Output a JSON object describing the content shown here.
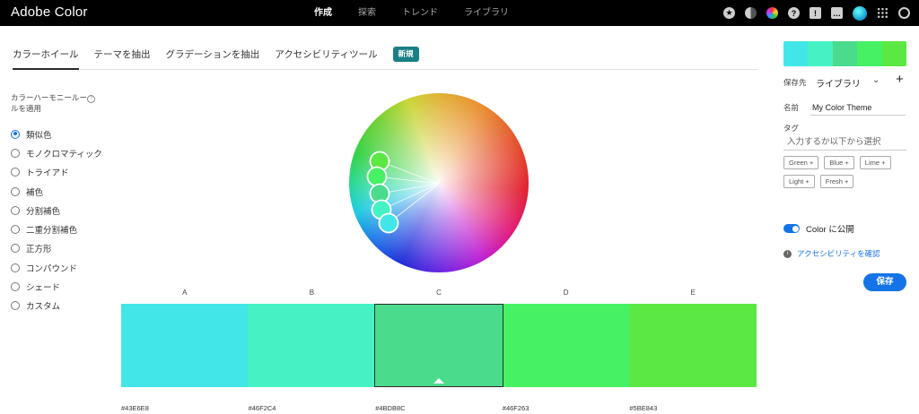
{
  "app": {
    "brand": "Adobe Color",
    "nav": [
      "作成",
      "探索",
      "トレンド",
      "ライブラリ"
    ],
    "active_nav": 0
  },
  "header_icons": [
    "star-icon",
    "contrast-icon",
    "color-wheel-icon",
    "help-icon",
    "alert-icon",
    "chat-icon",
    "avatar",
    "apps-grid-icon",
    "creative-cloud-icon"
  ],
  "tabs": {
    "items": [
      "カラーホイール",
      "テーマを抽出",
      "グラデーションを抽出",
      "アクセシビリティツール"
    ],
    "active": 0,
    "new_badge": "新規"
  },
  "harmony": {
    "title": "カラーハーモニールールを適用",
    "help": "?",
    "rules": [
      "類似色",
      "モノクロマティック",
      "トライアド",
      "補色",
      "分割補色",
      "二重分割補色",
      "正方形",
      "コンパウンド",
      "シェード",
      "カスタム"
    ],
    "selected": 0
  },
  "swatches": [
    {
      "label": "A",
      "hex": "#43E6E8"
    },
    {
      "label": "B",
      "hex": "#46F2C4"
    },
    {
      "label": "C",
      "hex": "#4BDB8C"
    },
    {
      "label": "D",
      "hex": "#46F263"
    },
    {
      "label": "E",
      "hex": "#5BE843"
    }
  ],
  "selected_swatch": 2,
  "panel": {
    "save_to_label": "保存先",
    "save_to_value": "ライブラリ",
    "name_label": "名前",
    "name_value": "My Color Theme",
    "tag_label": "タグ",
    "tag_placeholder": "入力するか以下から選択",
    "tags": [
      "Green +",
      "Blue +",
      "Lime +",
      "Light +",
      "Fresh +"
    ],
    "public_label": "Color に公開",
    "public_on": true,
    "a11y_link": "アクセシビリティを確認",
    "save_label": "保存"
  }
}
